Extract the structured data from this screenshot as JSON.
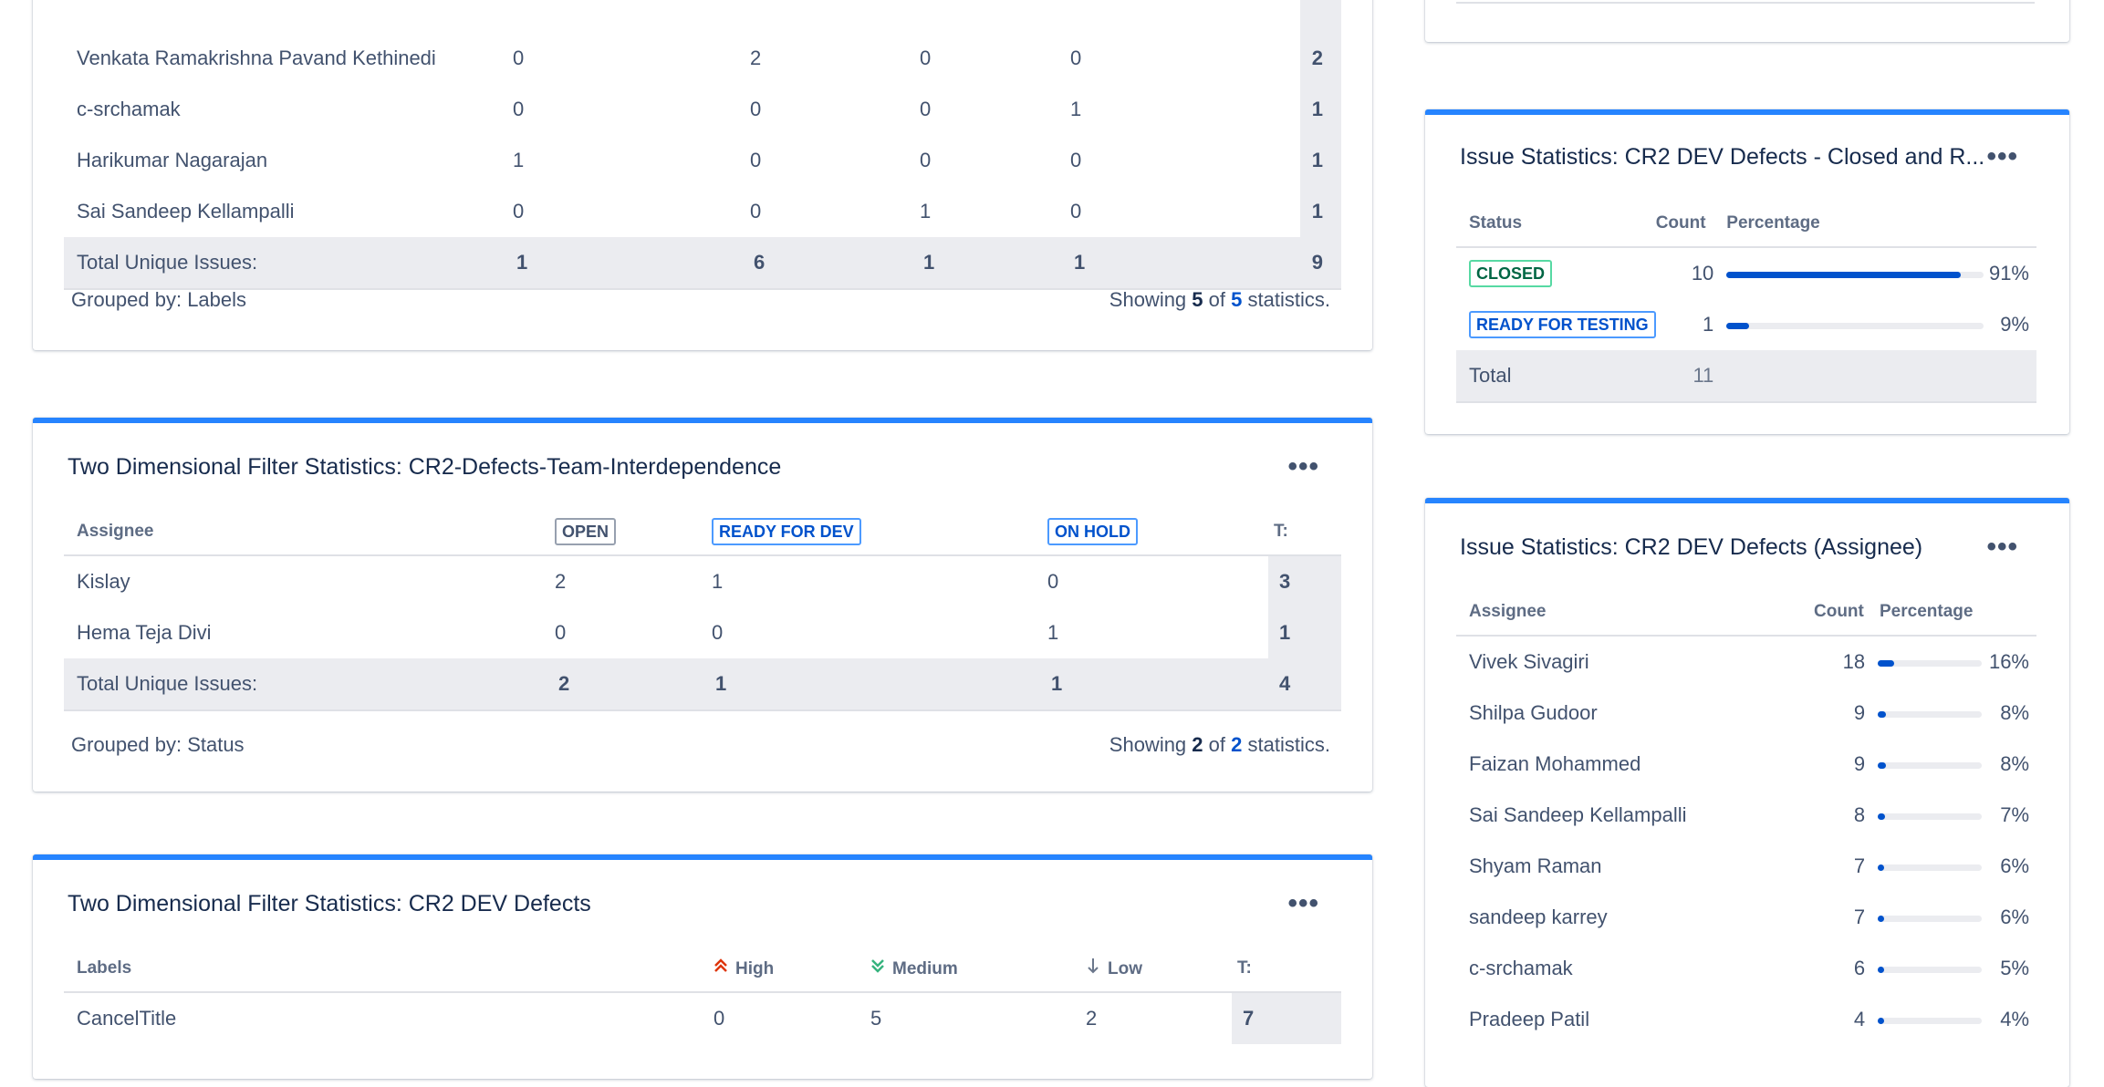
{
  "gadget1": {
    "rows": [
      {
        "name": "Venkata Ramakrishna Pavand Kethinedi",
        "c": [
          "0",
          "2",
          "0",
          "0"
        ],
        "t": "2"
      },
      {
        "name": "c-srchamak",
        "c": [
          "0",
          "0",
          "0",
          "1"
        ],
        "t": "1"
      },
      {
        "name": "Harikumar Nagarajan",
        "c": [
          "1",
          "0",
          "0",
          "0"
        ],
        "t": "1"
      },
      {
        "name": "Sai Sandeep Kellampalli",
        "c": [
          "0",
          "0",
          "1",
          "0"
        ],
        "t": "1"
      }
    ],
    "total_label": "Total Unique Issues:",
    "totals": [
      "1",
      "6",
      "1",
      "1"
    ],
    "grand_total": "9",
    "grouped_by": "Grouped by: Labels",
    "showing_prefix": "Showing",
    "showing_n": "5",
    "showing_of": "of",
    "showing_total": "5",
    "showing_suffix": "statistics."
  },
  "gadget2": {
    "title": "Two Dimensional Filter Statistics: CR2-Defects-Team-Interdependence",
    "menu": "•••",
    "col_label": "Assignee",
    "statuses": [
      "OPEN",
      "READY FOR DEV",
      "ON HOLD"
    ],
    "t_label": "T:",
    "rows": [
      {
        "name": "Kislay",
        "c": [
          "2",
          "1",
          "0"
        ],
        "t": "3"
      },
      {
        "name": "Hema Teja Divi",
        "c": [
          "0",
          "0",
          "1"
        ],
        "t": "1"
      }
    ],
    "total_label": "Total Unique Issues:",
    "totals": [
      "2",
      "1",
      "1"
    ],
    "grand_total": "4",
    "grouped_by": "Grouped by: Status",
    "showing_prefix": "Showing",
    "showing_n": "2",
    "showing_of": "of",
    "showing_total": "2",
    "showing_suffix": "statistics."
  },
  "gadget3": {
    "title": "Two Dimensional Filter Statistics: CR2 DEV Defects",
    "menu": "•••",
    "col_label": "Labels",
    "priorities": [
      "High",
      "Medium",
      "Low"
    ],
    "priority_icons": [
      "high-priority-icon",
      "medium-priority-icon",
      "low-priority-icon"
    ],
    "t_label": "T:",
    "rows": [
      {
        "name": "CancelTitle",
        "c": [
          "0",
          "5",
          "2"
        ],
        "t": "7"
      }
    ]
  },
  "gadget4": {
    "title": "Issue Statistics: CR2 DEV Defects - Closed and R...",
    "menu": "•••",
    "headers": {
      "status": "Status",
      "count": "Count",
      "percentage": "Percentage"
    },
    "rows": [
      {
        "status": "CLOSED",
        "count": "10",
        "pct": "91%",
        "fraction": 0.91
      },
      {
        "status": "READY FOR TESTING",
        "count": "1",
        "pct": "9%",
        "fraction": 0.09
      }
    ],
    "total_label": "Total",
    "total": "11"
  },
  "gadget5": {
    "title": "Issue Statistics: CR2 DEV Defects (Assignee)",
    "menu": "•••",
    "headers": {
      "assignee": "Assignee",
      "count": "Count",
      "percentage": "Percentage"
    },
    "rows": [
      {
        "name": "Vivek Sivagiri",
        "count": "18",
        "pct": "16%",
        "fraction": 0.16
      },
      {
        "name": "Shilpa Gudoor",
        "count": "9",
        "pct": "8%",
        "fraction": 0.08
      },
      {
        "name": "Faizan Mohammed",
        "count": "9",
        "pct": "8%",
        "fraction": 0.08
      },
      {
        "name": "Sai Sandeep Kellampalli",
        "count": "8",
        "pct": "7%",
        "fraction": 0.07
      },
      {
        "name": "Shyam Raman",
        "count": "7",
        "pct": "6%",
        "fraction": 0.06
      },
      {
        "name": "sandeep karrey",
        "count": "7",
        "pct": "6%",
        "fraction": 0.06
      },
      {
        "name": "c-srchamak",
        "count": "6",
        "pct": "5%",
        "fraction": 0.05
      },
      {
        "name": "Pradeep Patil",
        "count": "4",
        "pct": "4%",
        "fraction": 0.04
      }
    ]
  },
  "colors": {
    "accent": "#2684ff",
    "bar": "#0052cc",
    "high": "#de350b",
    "medium": "#36b37e",
    "low": "#6b778c"
  }
}
